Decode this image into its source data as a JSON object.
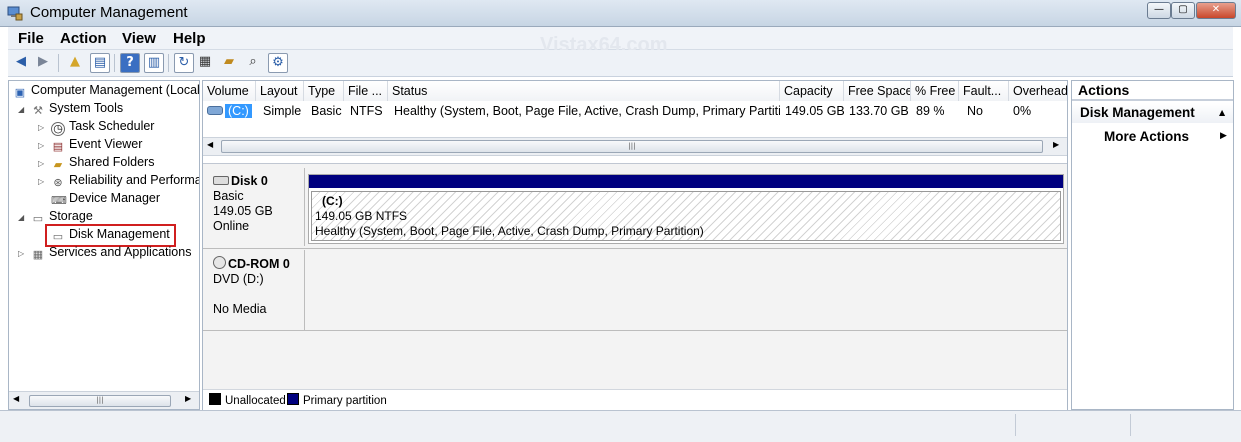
{
  "window": {
    "title": "Computer Management"
  },
  "menu": {
    "file": "File",
    "action": "Action",
    "view": "View",
    "help": "Help"
  },
  "watermark": "Vistax64.com",
  "tree": {
    "root": "Computer Management (Local",
    "system_tools": "System Tools",
    "task_scheduler": "Task Scheduler",
    "event_viewer": "Event Viewer",
    "shared_folders": "Shared Folders",
    "reliability": "Reliability and Performa",
    "device_manager": "Device Manager",
    "storage": "Storage",
    "disk_management": "Disk Management",
    "services": "Services and Applications"
  },
  "volumes": {
    "columns": {
      "volume": "Volume",
      "layout": "Layout",
      "type": "Type",
      "fs": "File ...",
      "status": "Status",
      "capacity": "Capacity",
      "free": "Free Space",
      "pct_free": "% Free",
      "fault": "Fault...",
      "overhead": "Overhead"
    },
    "row": {
      "volume": "(C:)",
      "layout": "Simple",
      "type": "Basic",
      "fs": "NTFS",
      "status": "Healthy (System, Boot, Page File, Active, Crash Dump, Primary Partition)",
      "capacity": "149.05 GB",
      "free": "133.70 GB",
      "pct_free": "89 %",
      "fault": "No",
      "overhead": "0%"
    }
  },
  "disks": {
    "disk0": {
      "name": "Disk 0",
      "type": "Basic",
      "size": "149.05 GB",
      "state": "Online",
      "partition": {
        "label": "(C:)",
        "size": "149.05 GB NTFS",
        "status": "Healthy (System, Boot, Page File, Active, Crash Dump, Primary Partition)"
      }
    },
    "cdrom0": {
      "name": "CD-ROM 0",
      "type": "DVD (D:)",
      "state": "No Media"
    }
  },
  "legend": {
    "unallocated": "Unallocated",
    "primary": "Primary partition"
  },
  "actions": {
    "header": "Actions",
    "section": "Disk Management",
    "more": "More Actions"
  },
  "colors": {
    "primary_partition": "#00007f",
    "unallocated": "#000000",
    "selection": "#3399ff"
  }
}
